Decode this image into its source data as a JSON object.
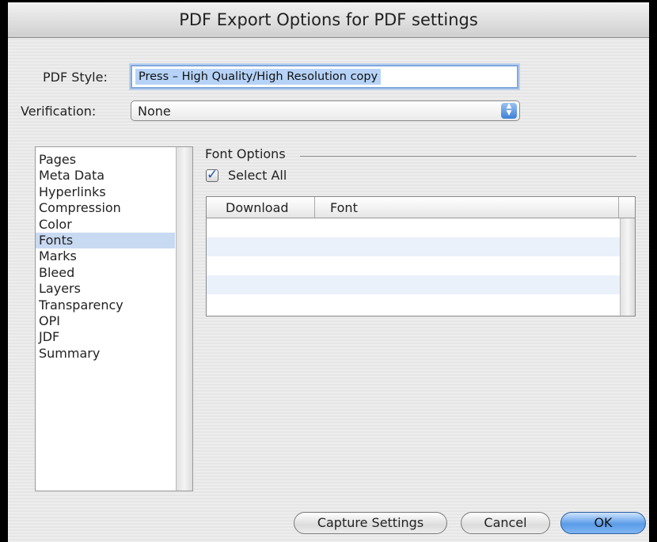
{
  "window": {
    "title": "PDF Export Options for PDF settings"
  },
  "form": {
    "pdf_style_label": "PDF Style:",
    "pdf_style_value": "Press – High Quality/High Resolution copy",
    "verification_label": "Verification:",
    "verification_value": "None"
  },
  "sidebar": {
    "items": [
      {
        "label": "Pages"
      },
      {
        "label": "Meta Data"
      },
      {
        "label": "Hyperlinks"
      },
      {
        "label": "Compression"
      },
      {
        "label": "Color"
      },
      {
        "label": "Fonts",
        "selected": true
      },
      {
        "label": "Marks"
      },
      {
        "label": "Bleed"
      },
      {
        "label": "Layers"
      },
      {
        "label": "Transparency"
      },
      {
        "label": "OPI"
      },
      {
        "label": "JDF"
      },
      {
        "label": "Summary"
      }
    ]
  },
  "font_options": {
    "group_title": "Font Options",
    "select_all_label": "Select All",
    "select_all_checked": true,
    "columns": [
      "Download",
      "Font"
    ]
  },
  "buttons": {
    "capture": "Capture Settings",
    "cancel": "Cancel",
    "ok": "OK"
  },
  "colors": {
    "accent": "#5a9be8",
    "selection": "#c8d9f2"
  }
}
